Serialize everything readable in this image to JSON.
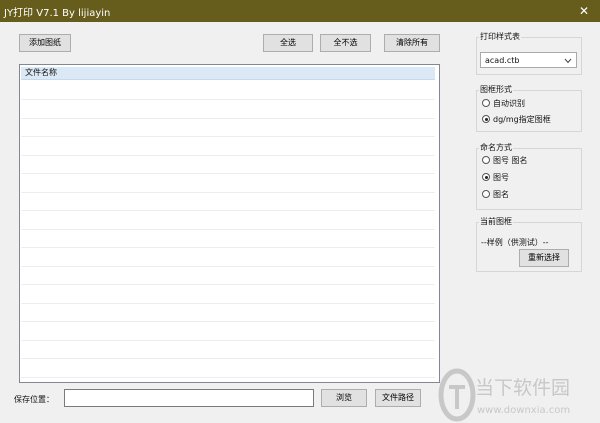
{
  "window": {
    "title": "JY打印 V7.1 By lijiayin",
    "close_label": "✕"
  },
  "toolbar": {
    "add_drawing": "添加图纸",
    "select_all": "全选",
    "select_none": "全不选",
    "clear_all": "清除所有"
  },
  "file_list": {
    "header": "文件名称",
    "rows": 17
  },
  "print_style": {
    "title": "打印样式表",
    "selected": "acad.ctb"
  },
  "frame_form": {
    "title": "图框形式",
    "options": [
      "自动识别",
      "dg/mg指定图框"
    ],
    "selected_index": 1
  },
  "naming": {
    "title": "命名方式",
    "options": [
      "图号  图名",
      "图号",
      "图名"
    ],
    "selected_index": 1
  },
  "current_frame": {
    "title": "当前图框",
    "value": "--样例（供测试）--",
    "reselect_label": "重新选择"
  },
  "save": {
    "label": "保存位置：",
    "value": "",
    "browse_label": "浏览",
    "path_label": "文件路径"
  },
  "watermark": {
    "brand": "当下软件园",
    "url": "www.downxia.com"
  },
  "colors": {
    "titlebar": "#665d1c",
    "list_header": "#dbe8f5",
    "watermark_accent": "#c8c8c8"
  }
}
